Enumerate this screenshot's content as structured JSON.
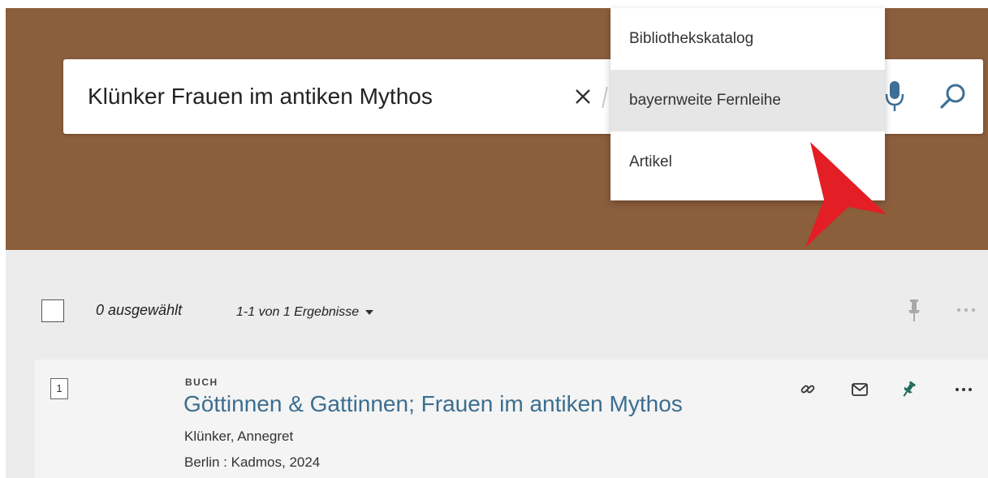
{
  "search": {
    "query": "Klünker Frauen im antiken Mythos",
    "icons": {
      "clear": "close-icon",
      "mic": "microphone-icon",
      "search": "search-icon"
    }
  },
  "scope_dropdown": {
    "items": [
      {
        "label": "Bibliothekskatalog",
        "active": false
      },
      {
        "label": "bayernweite Fernleihe",
        "active": true
      },
      {
        "label": "Artikel",
        "active": false
      }
    ]
  },
  "toolbar": {
    "selected_label": "0 ausgewählt",
    "results_label": "1-1 von 1 Ergebnisse"
  },
  "results": [
    {
      "number": "1",
      "type": "BUCH",
      "title": "Göttinnen & Gattinnen; Frauen im antiken Mythos",
      "author": "Klünker, Annegret",
      "publication": "Berlin : Kadmos, 2024"
    }
  ],
  "colors": {
    "header_brown": "#8b5e3c",
    "title_link": "#3b6e8f",
    "pin_active": "#1f6b5a",
    "arrow_red": "#e31e24"
  }
}
